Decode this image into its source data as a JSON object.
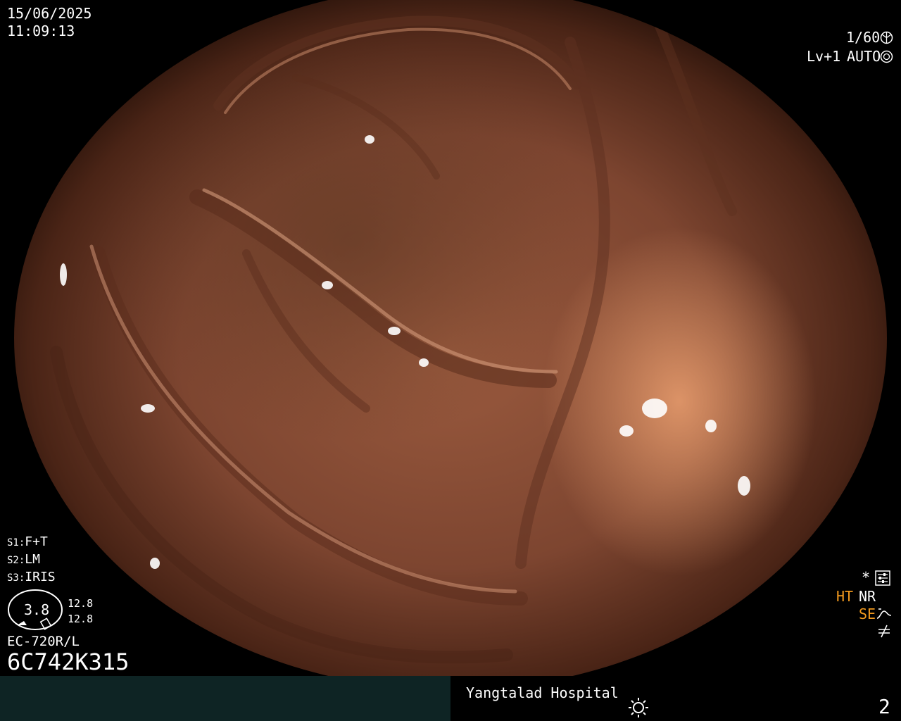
{
  "header": {
    "date": "15/06/2025",
    "time": "11:09:13"
  },
  "settings": {
    "shutter": "1/60",
    "level": "Lv+1",
    "iris_mode": "AUTO"
  },
  "scope_buttons": {
    "s1_key": "S1:",
    "s1_value": "F+T",
    "s2_key": "S2:",
    "s2_value": "LM",
    "s3_key": "S3:",
    "s3_value": "IRIS"
  },
  "gauge": {
    "center_value": "3.8",
    "upper_value": "12.8",
    "lower_value": "12.8"
  },
  "scope": {
    "model": "EC-720R/L",
    "serial": "6C742K315"
  },
  "indicators": {
    "asterisk": "*",
    "ht": "HT",
    "nr": "NR",
    "se": "SE",
    "ht_color": "#f39a1e",
    "se_color": "#f39a1e"
  },
  "footer": {
    "hospital": "Yangtalad Hospital",
    "page_number": "2"
  },
  "colors": {
    "footer_left_bg": "#0e2424",
    "mucosa": "#9a5a3e"
  }
}
